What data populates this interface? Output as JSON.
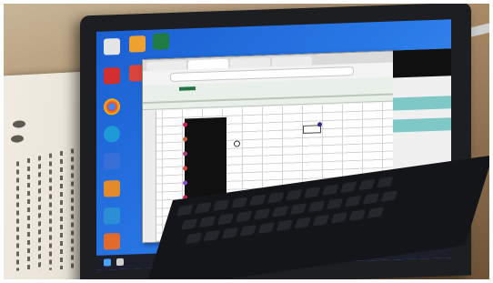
{
  "scene": {
    "description_free": true,
    "subject": "laptop",
    "colors": {
      "desktop": "#2a7ae8",
      "excel_green": "#217346",
      "taskbar": "#1c1f2a",
      "bezel": "#1d1e22"
    },
    "icons": {
      "desktop": [
        "app-icon",
        "folder-icon",
        "excel-icon",
        "pdf-icon",
        "office-icon",
        "chrome-icon",
        "edge-icon",
        "settings-icon",
        "app-icon",
        "app-icon",
        "app-icon",
        "app-icon"
      ],
      "taskbar": [
        "start-icon",
        "search-icon",
        "app-icon",
        "app-icon",
        "app-icon",
        "app-icon"
      ]
    }
  }
}
